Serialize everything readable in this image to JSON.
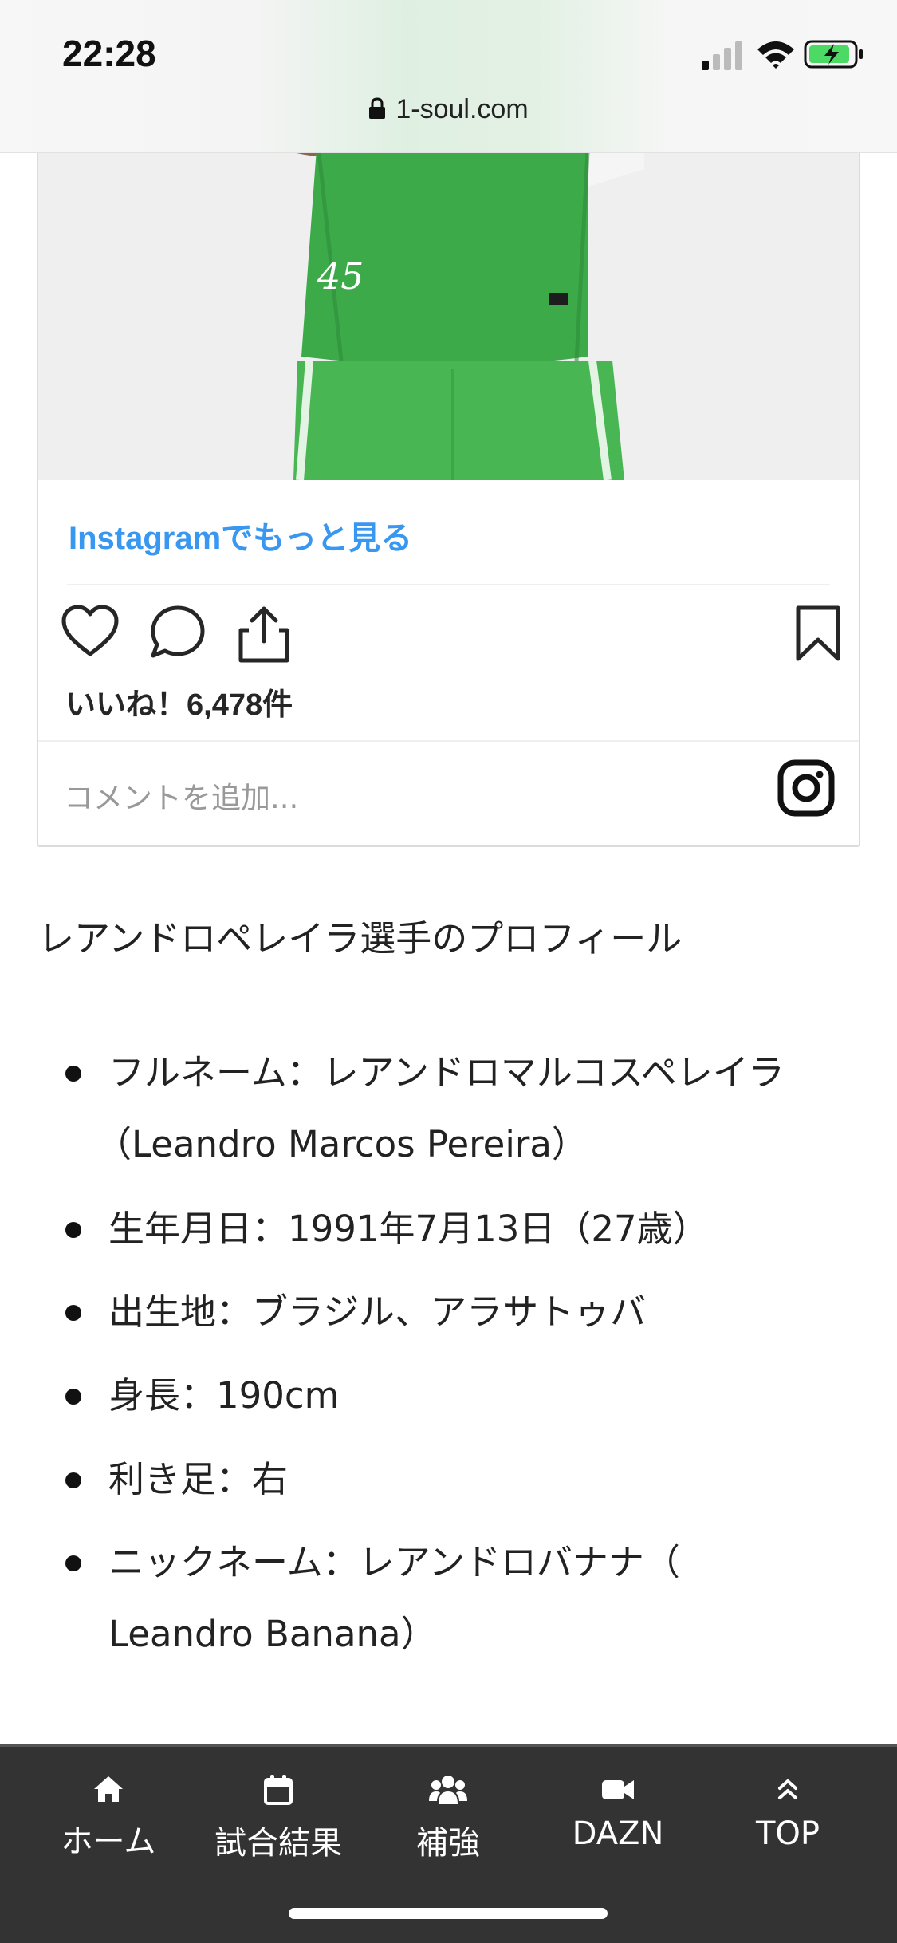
{
  "status_bar": {
    "time": "22:28",
    "url": "1-soul.com",
    "icons": [
      "signal-icon",
      "wifi-icon",
      "battery-charging-icon",
      "lock-icon"
    ]
  },
  "instagram_embed": {
    "more_link": "Instagramでもっと見る",
    "likes": "いいね！6,478件",
    "comment_placeholder": "コメントを追加...",
    "icons": [
      "heart-icon",
      "comment-icon",
      "share-icon",
      "bookmark-icon",
      "instagram-icon"
    ],
    "photo_jersey_mark": "45"
  },
  "profile": {
    "title": "レアンドロペレイラ選手のプロフィール",
    "items": [
      {
        "line1": "フルネーム：レアンドロマルコスペレイラ",
        "line2": "（Leandro Marcos Pereira）"
      },
      {
        "line1": "生年月日：1991年7月13日（27歳）"
      },
      {
        "line1": "出生地：ブラジル、アラサトゥバ"
      },
      {
        "line1": "身長：190cm"
      },
      {
        "line1": "利き足：右"
      },
      {
        "line1": "ニックネーム：レアンドロバナナ（",
        "line2": "Leandro Banana）"
      }
    ]
  },
  "bottom_nav": {
    "items": [
      {
        "label": "ホーム",
        "icon": "home-icon"
      },
      {
        "label": "試合結果",
        "icon": "calendar-icon"
      },
      {
        "label": "補強",
        "icon": "users-icon"
      },
      {
        "label": "DAZN",
        "icon": "video-camera-icon"
      },
      {
        "label": "TOP",
        "icon": "double-chevron-up-icon"
      }
    ]
  },
  "colors": {
    "link_blue": "#3897f0",
    "nav_background": "#333333",
    "jersey_green": "#3fa84a"
  }
}
